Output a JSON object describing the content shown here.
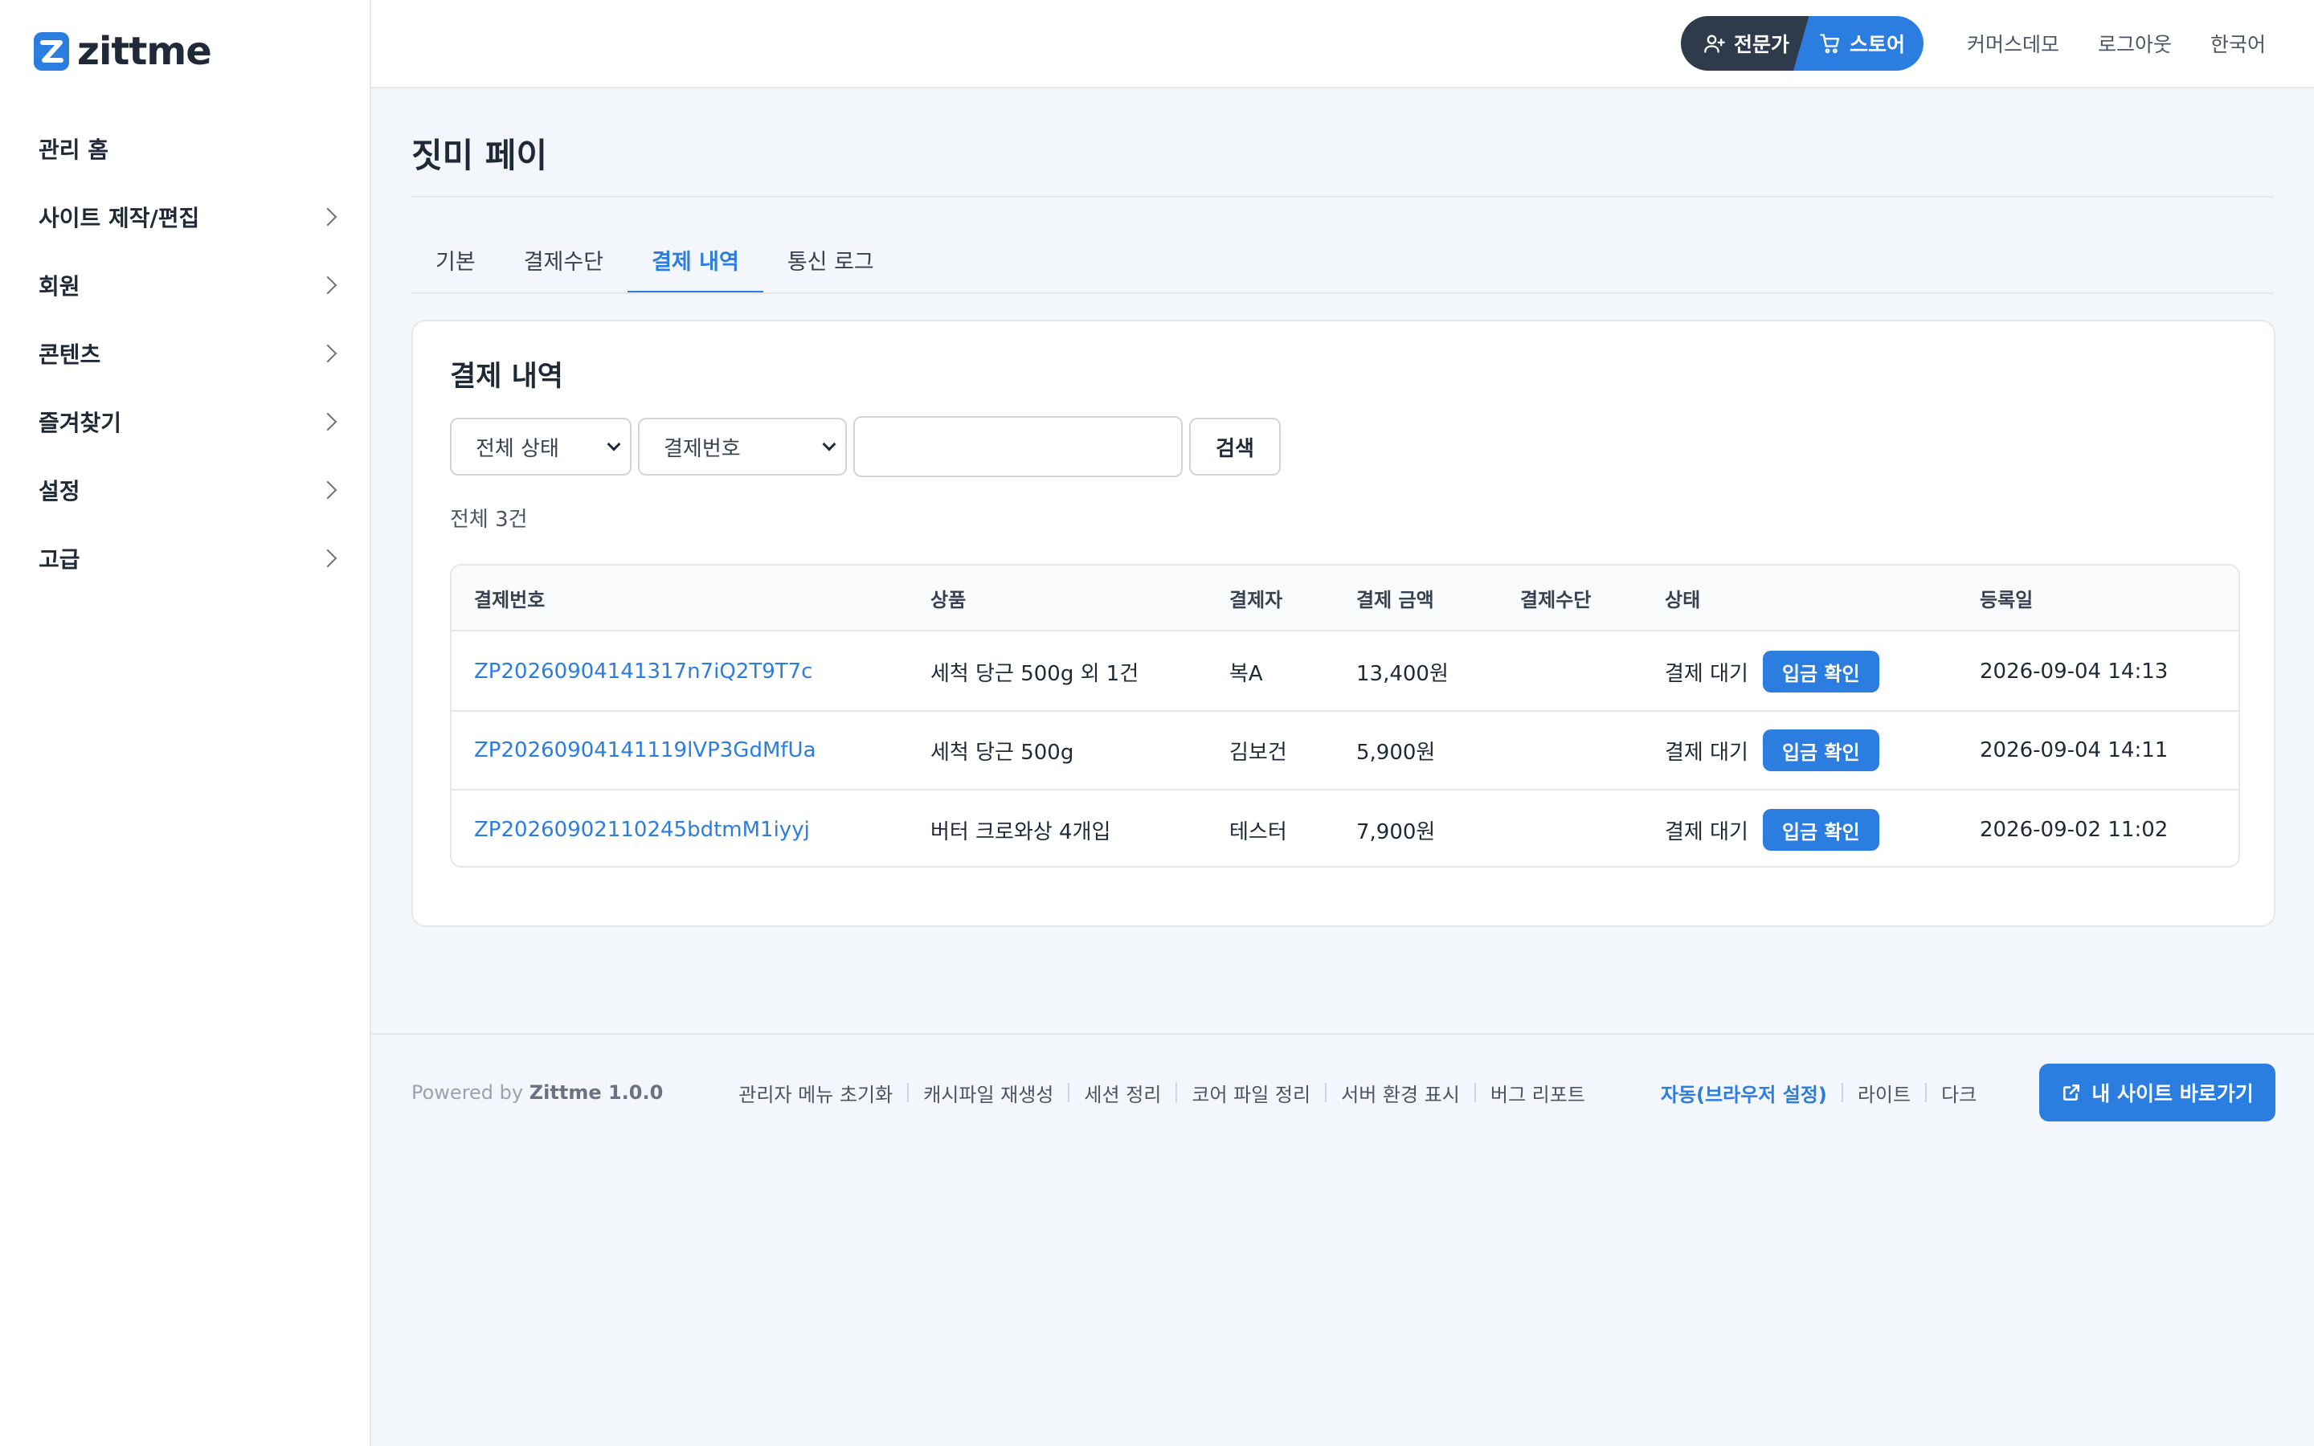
{
  "brand": {
    "name": "zittme",
    "color": "#2b7de0"
  },
  "sidebar": {
    "items": [
      {
        "label": "관리 홈",
        "has_children": false
      },
      {
        "label": "사이트 제작/편집",
        "has_children": true
      },
      {
        "label": "회원",
        "has_children": true
      },
      {
        "label": "콘텐츠",
        "has_children": true
      },
      {
        "label": "즐겨찾기",
        "has_children": true
      },
      {
        "label": "설정",
        "has_children": true
      },
      {
        "label": "고급",
        "has_children": true
      }
    ]
  },
  "header": {
    "mode_expert": "전문가",
    "mode_store": "스토어",
    "links": [
      "커머스데모",
      "로그아웃",
      "한국어"
    ]
  },
  "page": {
    "title": "짓미 페이",
    "tabs": [
      "기본",
      "결제수단",
      "결제 내역",
      "통신 로그"
    ],
    "active_tab": "결제 내역"
  },
  "card": {
    "title": "결제 내역",
    "filters": {
      "status_select": "전체 상태",
      "field_select": "결제번호",
      "search_value": "",
      "search_button": "검색"
    },
    "total": "전체 3건",
    "table": {
      "columns": [
        "결제번호",
        "상품",
        "결제자",
        "결제 금액",
        "결제수단",
        "상태",
        "등록일"
      ],
      "rows": [
        {
          "id": "ZP20260904141317n7iQ2T9T7c",
          "product": "세척 당근 500g 외 1건",
          "payer": "복A",
          "amount": "13,400원",
          "method": "",
          "status": "결제 대기",
          "action": "입금 확인",
          "date": "2026-09-04 14:13"
        },
        {
          "id": "ZP20260904141119lVP3GdMfUa",
          "product": "세척 당근 500g",
          "payer": "김보건",
          "amount": "5,900원",
          "method": "",
          "status": "결제 대기",
          "action": "입금 확인",
          "date": "2026-09-04 14:11"
        },
        {
          "id": "ZP20260902110245bdtmM1iyyj",
          "product": "버터 크로와상 4개입",
          "payer": "테스터",
          "amount": "7,900원",
          "method": "",
          "status": "결제 대기",
          "action": "입금 확인",
          "date": "2026-09-02 11:02"
        }
      ]
    }
  },
  "footer": {
    "powered_prefix": "Powered by",
    "powered_name": "Zittme 1.0.0",
    "links": [
      "관리자 메뉴 초기화",
      "캐시파일 재생성",
      "세션 정리",
      "코어 파일 정리",
      "서버 환경 표시",
      "버그 리포트"
    ],
    "themes": [
      "자동(브라우저 설정)",
      "라이트",
      "다크"
    ],
    "active_theme": "자동(브라우저 설정)",
    "visit_button": "내 사이트 바로가기"
  }
}
